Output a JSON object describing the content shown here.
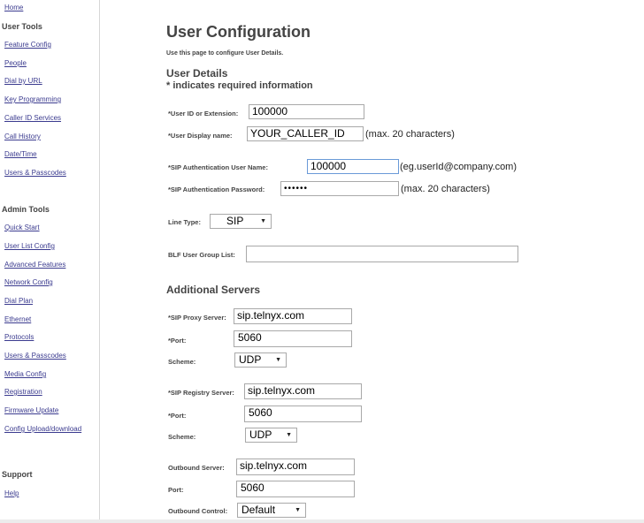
{
  "sidebar": {
    "home": "Home",
    "user_tools_heading": "User Tools",
    "user_tools": [
      "Feature Config",
      "People",
      "Dial by URL",
      "Key Programming",
      "Caller ID Services",
      "Call History",
      "Date/Time",
      "Users & Passcodes"
    ],
    "admin_tools_heading": "Admin Tools",
    "admin_tools": [
      "Quick Start",
      "User List Config",
      "Advanced Features",
      "Network Config",
      "Dial Plan",
      "Ethernet",
      "Protocols",
      "Users & Passcodes",
      "Media Config",
      "Registration",
      "Firmware Update",
      "Config Upload/download"
    ],
    "support_heading": "Support",
    "support": [
      "Help"
    ]
  },
  "page": {
    "title": "User Configuration",
    "description": "Use this page to configure User Details.",
    "user_details_heading": "User Details",
    "required_note": "* indicates required information"
  },
  "user_details": {
    "user_id_label": "*User ID or Extension:",
    "user_id_value": "100000",
    "display_name_label": "*User Display name:",
    "display_name_value": "YOUR_CALLER_ID",
    "display_name_hint": "(max. 20 characters)",
    "sip_user_label": "*SIP Authentication User Name:",
    "sip_user_value": "100000",
    "sip_user_hint": "(eg.userId@company.com)",
    "sip_pass_label": "*SIP Authentication Password:",
    "sip_pass_value": "••••••",
    "sip_pass_hint": "(max. 20 characters)",
    "line_type_label": "Line Type:",
    "line_type_value": "SIP",
    "blf_label": "BLF User Group List:",
    "blf_value": ""
  },
  "additional_servers": {
    "heading": "Additional Servers",
    "proxy_label": "*SIP Proxy Server:",
    "proxy_value": "sip.telnyx.com",
    "proxy_port_label": "*Port:",
    "proxy_port_value": "5060",
    "proxy_scheme_label": "Scheme:",
    "proxy_scheme_value": "UDP",
    "registry_label": "*SIP Registry Server:",
    "registry_value": "sip.telnyx.com",
    "registry_port_label": "*Port:",
    "registry_port_value": "5060",
    "registry_scheme_label": "Scheme:",
    "registry_scheme_value": "UDP",
    "outbound_label": "Outbound Server:",
    "outbound_value": "sip.telnyx.com",
    "outbound_port_label": "Port:",
    "outbound_port_value": "5060",
    "outbound_control_label": "Outbound Control:",
    "outbound_control_value": "Default"
  }
}
